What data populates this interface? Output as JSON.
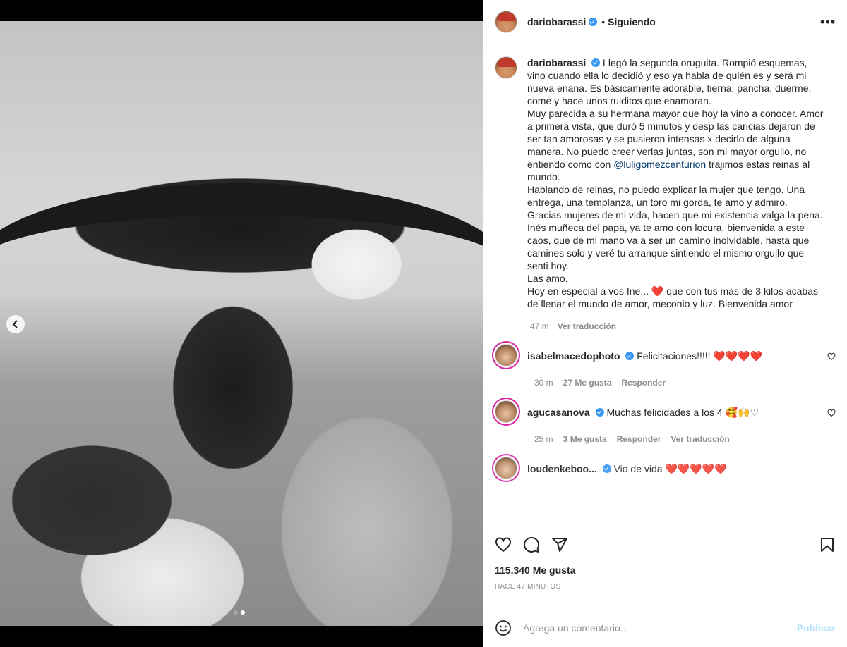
{
  "post": {
    "username": "dariobarassi",
    "separator": "•",
    "following_label": "Siguiendo",
    "more_label": "•••"
  },
  "caption": {
    "username": "dariobarassi",
    "text_before_mention": "Llegó la segunda oruguita. Rompió esquemas, vino cuando ella lo decidió y eso ya habla de quién es y será mi nueva enana. Es básicamente adorable, tierna, pancha, duerme, come y hace unos ruiditos que enamoran.\nMuy parecida a su hermana mayor que hoy la vino a conocer. Amor a primera vista, que duró 5 minutos y desp las caricias dejaron de ser tan amorosas y se pusieron intensas x decirlo de alguna manera. No puedo creer verlas juntas, son mi mayor orgullo, no entiendo como con ",
    "mention": "@luligomezcenturion",
    "text_after_mention": " trajimos estas reinas al mundo.\nHablando de reinas, no puedo explicar la mujer que tengo. Una entrega, una templanza, un toro mi gorda, te amo y admiro.\nGracias mujeres de mi vida, hacen que mi existencia valga la pena.\nInés muñeca del papa, ya te amo con locura, bienvenida a este caos, que de mi mano va a ser un camino inolvidable, hasta que camines solo y veré tu arranque sintiendo el mismo orgullo que senti hoy.\nLas amo.\nHoy en especial a vos Ine... ",
    "heart": "❤️",
    "text_end": " que con tus más de 3 kilos acabas de llenar el mundo de amor, meconio y luz. Bienvenida amor",
    "time": "47 m",
    "translate_label": "Ver traducción"
  },
  "comments": [
    {
      "username": "isabelmacedophoto",
      "text": "Felicitaciones!!!!! ",
      "hearts": "❤️❤️❤️❤️",
      "time": "30 m",
      "likes": "27 Me gusta",
      "reply": "Responder"
    },
    {
      "username": "agucasanova",
      "text": "Muchas felicidades a los 4 🥰🙌♡",
      "time": "25 m",
      "likes": "3 Me gusta",
      "reply": "Responder",
      "translate": "Ver traducción"
    },
    {
      "username": "loudenkeboo...",
      "text": "Vio de vida ",
      "hearts": "❤️❤️❤️❤️❤️"
    }
  ],
  "actions": {
    "likes_count": "115,340 Me gusta",
    "posted_ago": "HACE 47 MINUTOS"
  },
  "add_comment": {
    "placeholder": "Agrega un comentario...",
    "publish": "Publicar"
  },
  "colors": {
    "verified": "#3897f0",
    "publish_disabled": "#b2dffc",
    "heart": "#e0112b"
  }
}
